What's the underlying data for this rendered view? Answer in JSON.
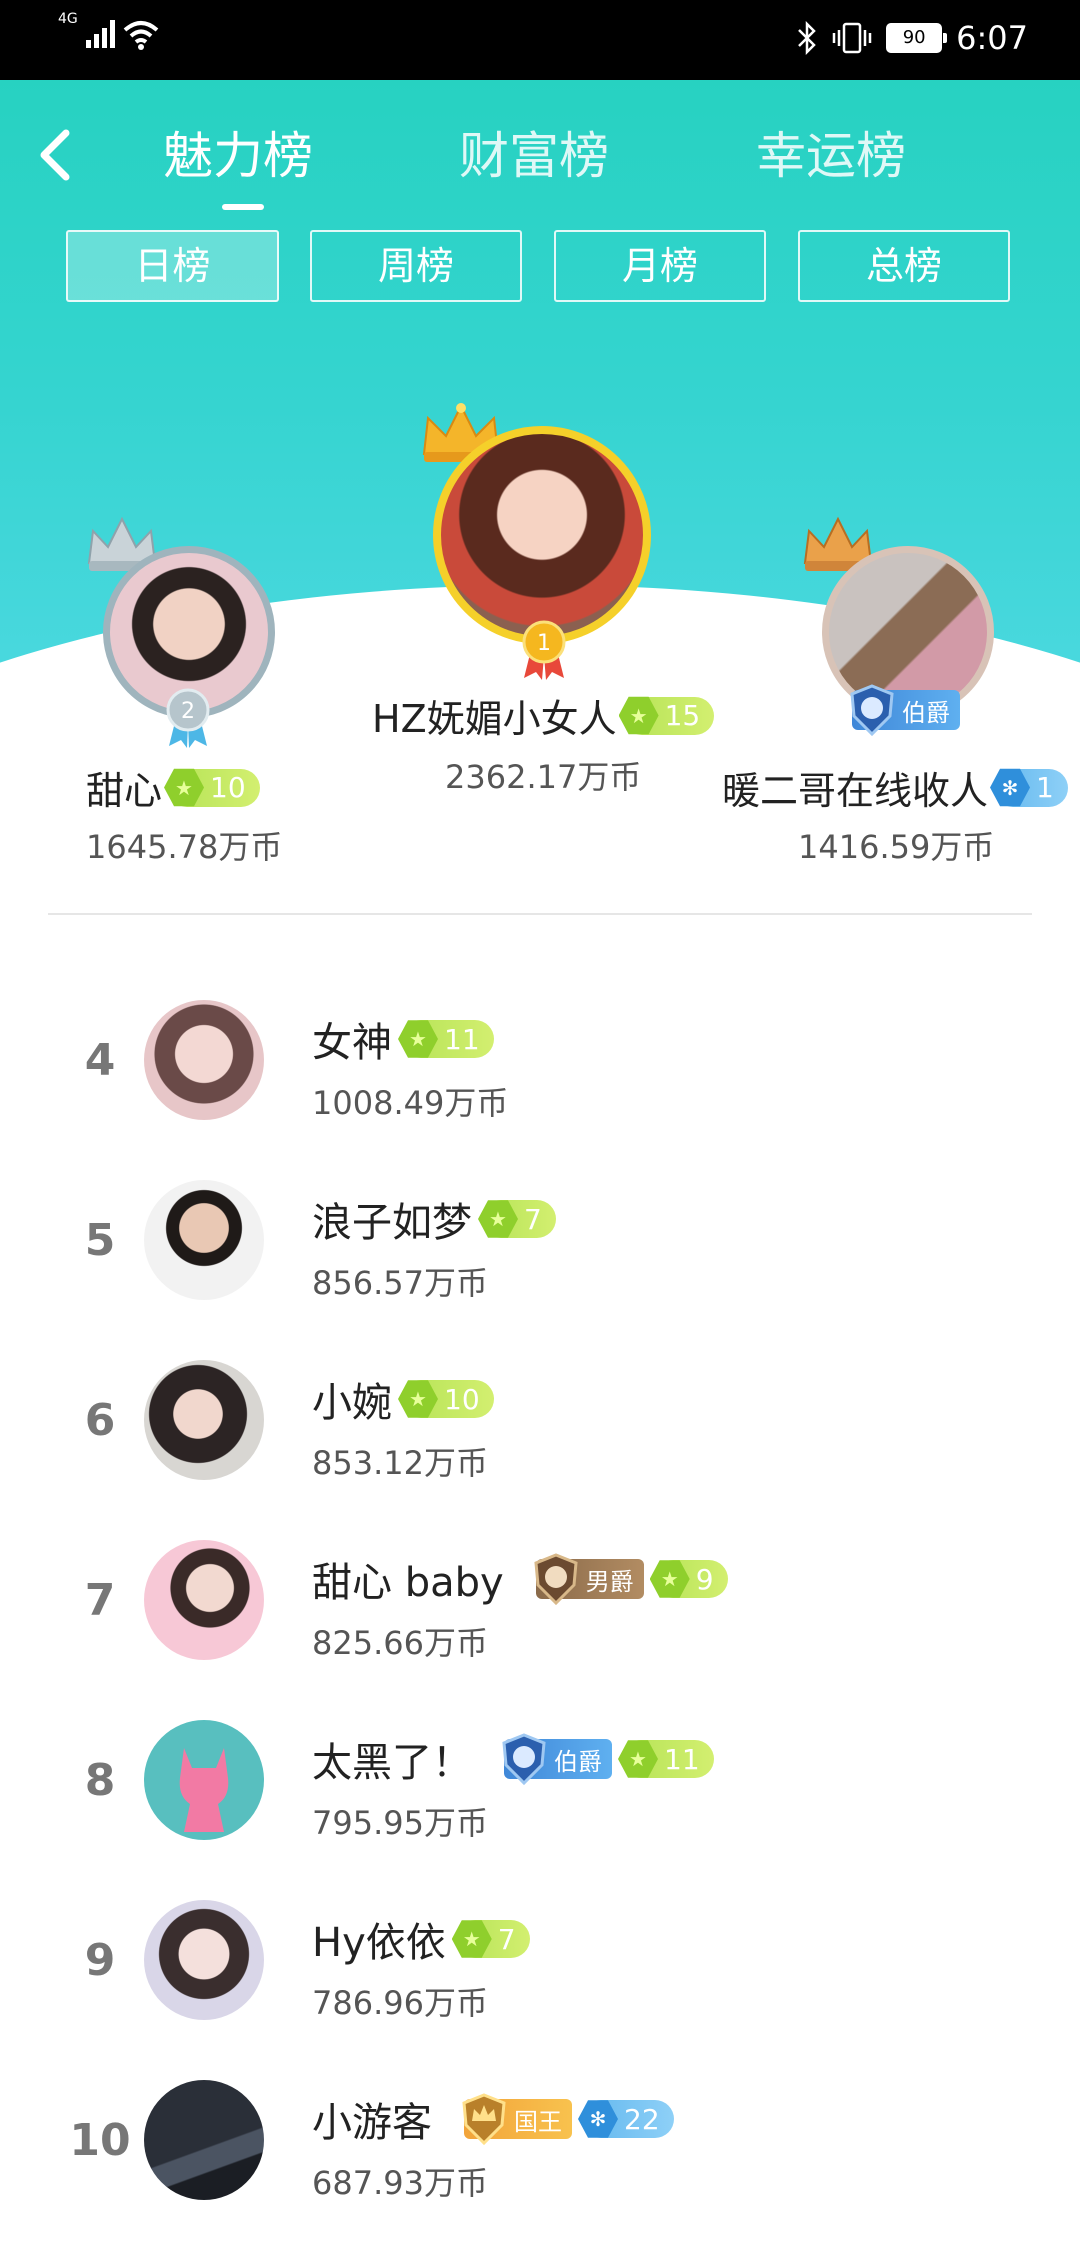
{
  "status_bar": {
    "network": "4G",
    "battery": "90",
    "time": "6:07"
  },
  "tabs": [
    {
      "label": "魅力榜",
      "active": true
    },
    {
      "label": "财富榜",
      "active": false
    },
    {
      "label": "幸运榜",
      "active": false
    }
  ],
  "periods": [
    {
      "label": "日榜",
      "active": true
    },
    {
      "label": "周榜",
      "active": false
    },
    {
      "label": "月榜",
      "active": false
    },
    {
      "label": "总榜",
      "active": false
    }
  ],
  "podium": {
    "first": {
      "rank": "1",
      "name": "HZ妩媚小女人",
      "level": "15",
      "coins": "2362.17万币"
    },
    "second": {
      "rank": "2",
      "name": "甜心",
      "level": "10",
      "coins": "1645.78万币"
    },
    "third": {
      "name": "暖二哥在线收人",
      "title": "伯爵",
      "level": "1",
      "coins": "1416.59万币"
    }
  },
  "list": [
    {
      "rank": "4",
      "name": "女神",
      "level": "11",
      "coins": "1008.49万币"
    },
    {
      "rank": "5",
      "name": "浪子如梦",
      "level": "7",
      "coins": "856.57万币"
    },
    {
      "rank": "6",
      "name": "小婉",
      "level": "10",
      "coins": "853.12万币"
    },
    {
      "rank": "7",
      "name": "甜心 baby",
      "title": "男爵",
      "level": "9",
      "coins": "825.66万币"
    },
    {
      "rank": "8",
      "name": "太黑了！",
      "title": "伯爵",
      "level": "11",
      "coins": "795.95万币"
    },
    {
      "rank": "9",
      "name": "Hy依依",
      "level": "7",
      "coins": "786.96万币"
    },
    {
      "rank": "10",
      "name": "小游客",
      "title": "国王",
      "level": "22",
      "coins": "687.93万币"
    }
  ],
  "colors": {
    "header_gradient_top": "#27d2c1",
    "header_gradient_bottom": "#4ad8df",
    "level_green": "#b5e356",
    "level_blue": "#62b7ee",
    "gold_ring": "#f5d02a",
    "silver_ring": "#9fb4bd"
  }
}
